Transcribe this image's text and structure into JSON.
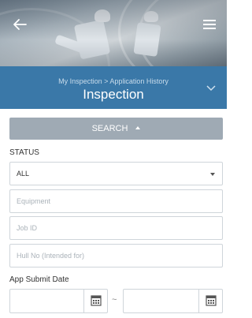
{
  "header": {
    "back_icon": "arrow-left-icon",
    "menu_icon": "hamburger-menu-icon",
    "breadcrumb": "My Inspection > Application History",
    "title": "Inspection",
    "expand_icon": "chevron-down-icon"
  },
  "search": {
    "toggle_label": "SEARCH",
    "toggle_icon": "caret-up-icon"
  },
  "form": {
    "status_label": "STATUS",
    "status_value": "ALL",
    "equipment_placeholder": "Equipment",
    "job_id_placeholder": "Job ID",
    "hull_no_placeholder": "Hull No (Intended for)",
    "submit_date_label": "App Submit Date",
    "date_separator": "~",
    "calendar_icon": "calendar-icon"
  },
  "colors": {
    "title_bar": "#3a78a8",
    "search_bar": "#9faab4",
    "border": "#cfd5da"
  }
}
